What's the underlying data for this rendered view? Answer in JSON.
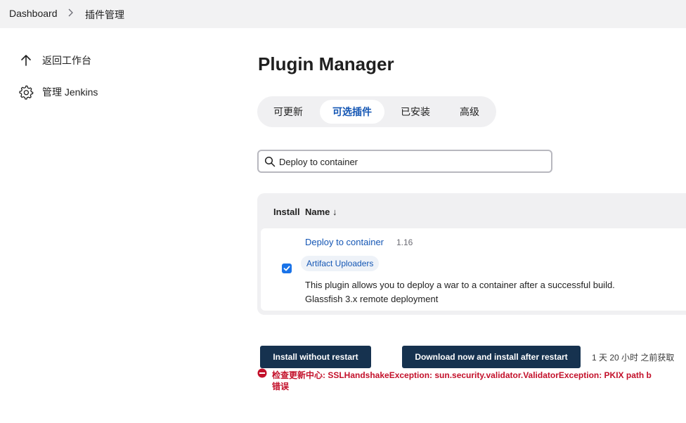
{
  "breadcrumb": {
    "items": [
      "Dashboard",
      "插件管理"
    ]
  },
  "sidebar": {
    "items": [
      {
        "label": "返回工作台",
        "icon": "arrow-up-icon"
      },
      {
        "label": "管理 Jenkins",
        "icon": "gear-icon"
      }
    ]
  },
  "main": {
    "title": "Plugin Manager",
    "tabs": [
      {
        "label": "可更新",
        "active": false
      },
      {
        "label": "可选插件",
        "active": true
      },
      {
        "label": "已安装",
        "active": false
      },
      {
        "label": "高级",
        "active": false
      }
    ],
    "search": {
      "value": "Deploy to container",
      "icon": "search-icon"
    },
    "table": {
      "headers": {
        "install": "Install",
        "name": "Name ↓"
      },
      "rows": [
        {
          "checked": true,
          "name": "Deploy to container",
          "version": "1.16",
          "tag": "Artifact Uploaders",
          "description_lines": [
            "This plugin allows you to deploy a war to a container after a successful build.",
            "Glassfish 3.x remote deployment"
          ]
        }
      ]
    },
    "buttons": {
      "install_without_restart": "Install without restart",
      "download_install_after_restart": "Download now and install after restart"
    },
    "updated_text": "1 天 20 小时 之前获取",
    "error": {
      "line1": "检查更新中心: SSLHandshakeException: sun.security.validator.ValidatorException: PKIX path b",
      "line2": "错误"
    }
  },
  "colors": {
    "accent": "#1456b4",
    "button_bg": "#16324f",
    "error": "#c3102a",
    "panel_bg": "#f0f0f2"
  }
}
